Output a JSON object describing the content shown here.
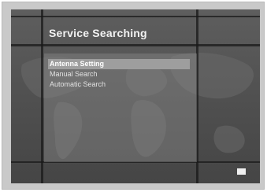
{
  "screen": {
    "title": "Service Searching",
    "menu_items": [
      {
        "label": "Antenna Setting",
        "selected": true
      },
      {
        "label": "Manual Search",
        "selected": false
      },
      {
        "label": "Automatic Search",
        "selected": false
      }
    ]
  },
  "colors": {
    "frame": "#c9c9c9",
    "screen_background": "#545454",
    "highlight": "#9e9e9e",
    "text": "#e2e2e2"
  }
}
